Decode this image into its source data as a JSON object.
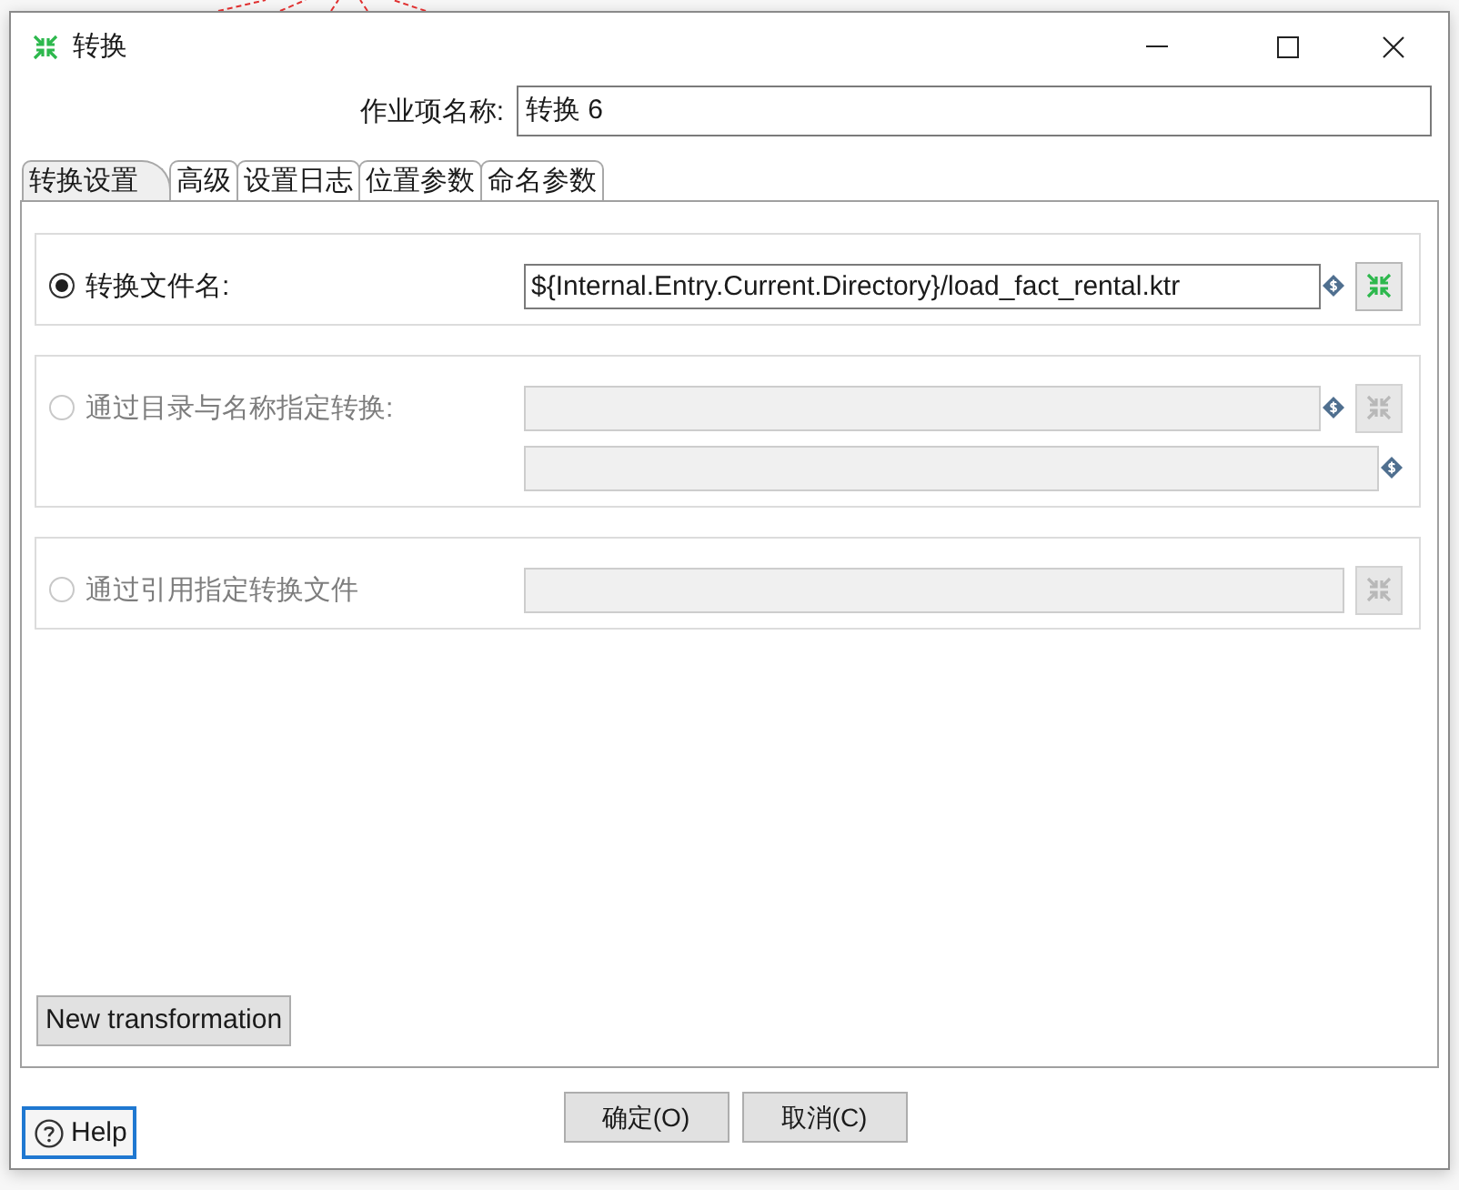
{
  "window": {
    "title": "转换"
  },
  "job_name": {
    "label": "作业项名称:",
    "value": "转换 6"
  },
  "tabs": [
    {
      "label": "转换设置",
      "selected": true
    },
    {
      "label": "高级",
      "selected": false
    },
    {
      "label": "设置日志",
      "selected": false
    },
    {
      "label": "位置参数",
      "selected": false
    },
    {
      "label": "命名参数",
      "selected": false
    }
  ],
  "options": [
    {
      "label": "转换文件名:",
      "selected": true,
      "disabled": false,
      "fields": [
        {
          "value": "${Internal.Entry.Current.Directory}/load_fact_rental.ktr",
          "variable": true,
          "browse": true
        }
      ]
    },
    {
      "label": "通过目录与名称指定转换:",
      "selected": false,
      "disabled": true,
      "fields": [
        {
          "variable": true,
          "browse": true
        },
        {
          "variable": true,
          "browse": false
        }
      ]
    },
    {
      "label": "通过引用指定转换文件",
      "selected": false,
      "disabled": true,
      "fields": [
        {
          "variable": false,
          "browse": true
        }
      ]
    }
  ],
  "new_button": {
    "label": "New transformation"
  },
  "help_button": {
    "label": "Help",
    "focused": true
  },
  "buttons": [
    {
      "label": "确定(O)",
      "focused": false
    },
    {
      "label": "取消(C)",
      "focused": false
    }
  ]
}
